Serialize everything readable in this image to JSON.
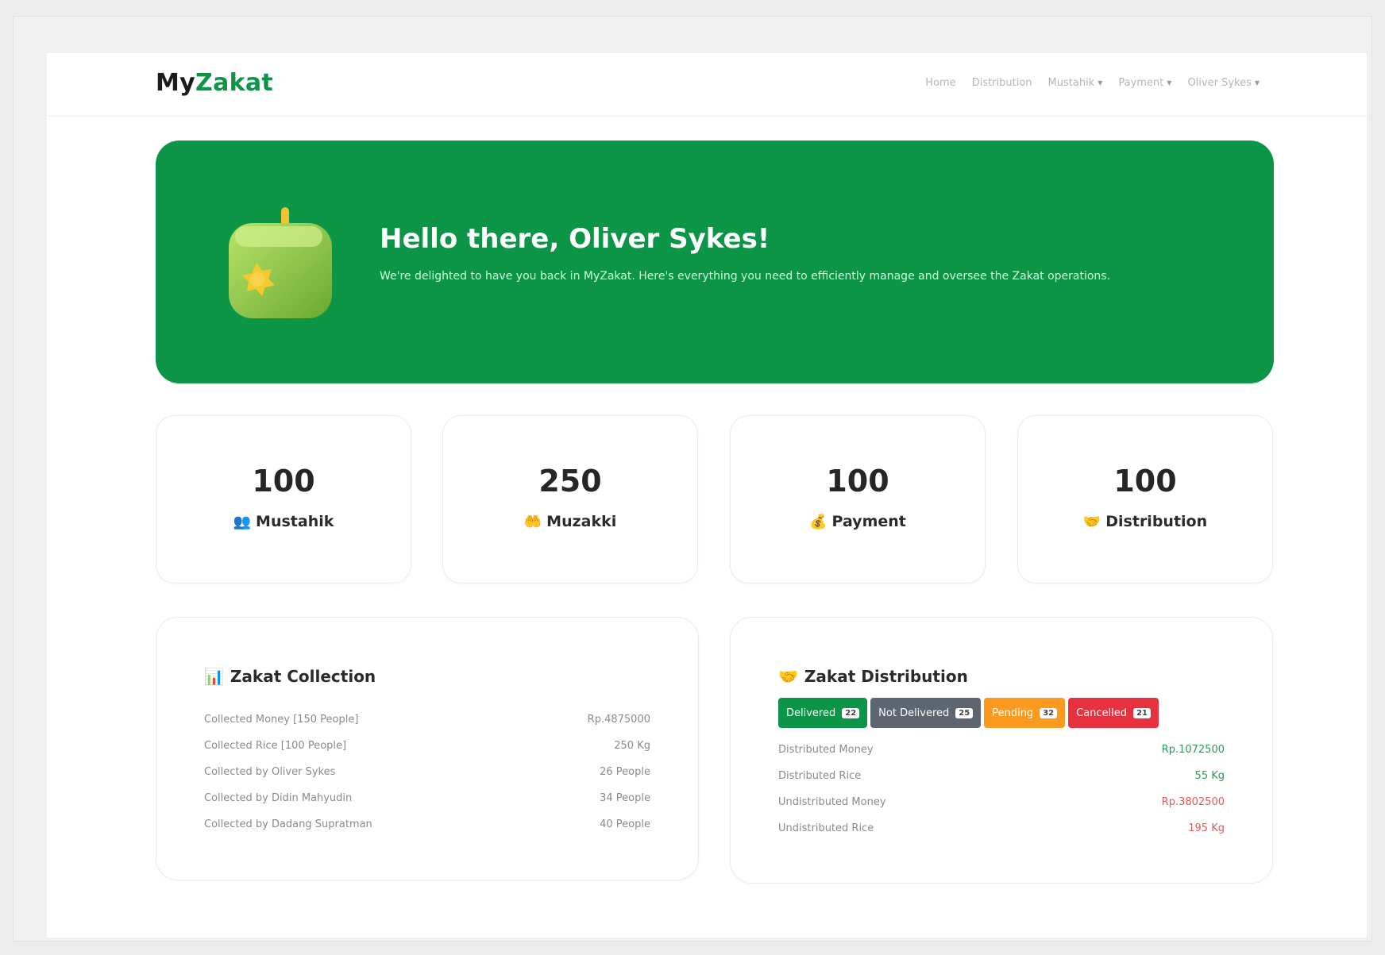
{
  "brand": {
    "prefix": "My",
    "accent": "Zakat"
  },
  "nav": {
    "home": "Home",
    "distribution": "Distribution",
    "mustahik": "Mustahik",
    "payment": "Payment",
    "user": "Oliver Sykes"
  },
  "hero": {
    "title": "Hello there, Oliver Sykes!",
    "subtitle": "We're delighted to have you back in MyZakat. Here's everything you need to efficiently manage and oversee the Zakat operations."
  },
  "stats": [
    {
      "value": "100",
      "label": "Mustahik",
      "icon": "people-icon"
    },
    {
      "value": "250",
      "label": "Muzakki",
      "icon": "hand-icon"
    },
    {
      "value": "100",
      "label": "Payment",
      "icon": "money-bag-icon"
    },
    {
      "value": "100",
      "label": "Distribution",
      "icon": "distribution-icon"
    }
  ],
  "collection": {
    "title": "Zakat Collection",
    "rows": [
      {
        "label": "Collected Money [150 People]",
        "value": "Rp.4875000"
      },
      {
        "label": "Collected Rice [100 People]",
        "value": "250 Kg"
      },
      {
        "label": "Collected by Oliver Sykes",
        "value": "26 People"
      },
      {
        "label": "Collected by Didin Mahyudin",
        "value": "34 People"
      },
      {
        "label": "Collected by Dadang Supratman",
        "value": "40 People"
      }
    ]
  },
  "distribution": {
    "title": "Zakat Distribution",
    "badges": [
      {
        "label": "Delivered",
        "count": "22"
      },
      {
        "label": "Not Delivered",
        "count": "25"
      },
      {
        "label": "Pending",
        "count": "32"
      },
      {
        "label": "Cancelled",
        "count": "21"
      }
    ],
    "rows": [
      {
        "label": "Distributed Money",
        "value": "Rp.1072500"
      },
      {
        "label": "Distributed Rice",
        "value": "55 Kg"
      },
      {
        "label": "Undistributed Money",
        "value": "Rp.3802500"
      },
      {
        "label": "Undistributed Rice",
        "value": "195 Kg"
      }
    ]
  },
  "colors": {
    "brand_green": "#0c9447",
    "gray": "#5d6570",
    "orange": "#fb9a1e",
    "red": "#e8313e"
  }
}
